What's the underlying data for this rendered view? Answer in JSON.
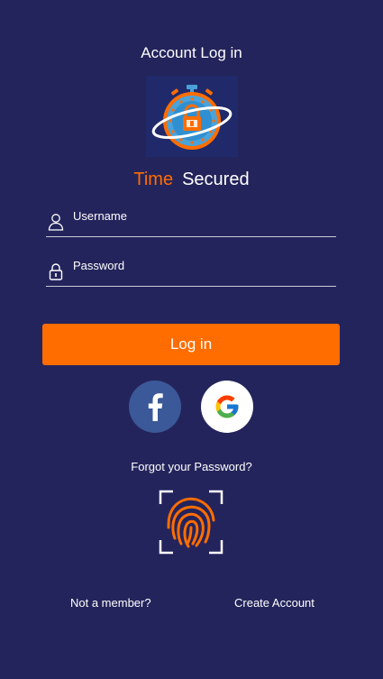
{
  "header": {
    "title": "Account Log in"
  },
  "brand": {
    "word1": "Time",
    "word2": "Secured",
    "accent_color": "#ff6d00",
    "logo_icon": "stopwatch-lock-logo"
  },
  "form": {
    "username_label": "Username",
    "password_label": "Password",
    "username_icon": "user-icon",
    "password_icon": "lock-icon",
    "login_label": "Log in"
  },
  "social": {
    "facebook_icon": "facebook-icon",
    "google_icon": "google-icon"
  },
  "links": {
    "forgot_password": "Forgot your Password?",
    "not_member": "Not a member?",
    "create_account": "Create Account"
  },
  "biometric": {
    "icon": "fingerprint-icon"
  },
  "colors": {
    "background": "#24245c",
    "primary_button": "#ff6d00",
    "facebook": "#3b5898"
  }
}
